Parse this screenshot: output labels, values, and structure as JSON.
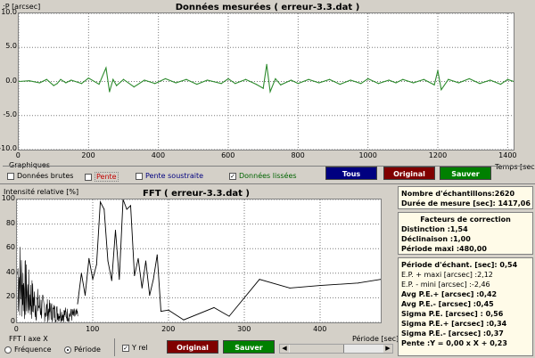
{
  "top": {
    "title": "Données mesurées ( erreur-3.3.dat )",
    "ylabel": ":P [arcsec]",
    "xlabel": "Temps [sec]",
    "yticks": [
      "10.0",
      "5.0",
      "0.0",
      "-5.0",
      "-10.0"
    ],
    "xticks": [
      "0",
      "200",
      "400",
      "600",
      "800",
      "1000",
      "1200",
      "1400"
    ]
  },
  "graphiques": {
    "label": "Graphiques",
    "cb_brutes": "Données brutes",
    "cb_pente": "Pente",
    "cb_soustraite": "Pente soustraite",
    "cb_lissees": "Données lissées",
    "btn_tous": "Tous",
    "btn_original": "Original",
    "btn_sauver": "Sauver"
  },
  "fft": {
    "title": "FFT ( erreur-3.3.dat )",
    "ylabel": "Intensité relative [%]",
    "xlabel": "Période [sec]",
    "yticks": [
      "100",
      "80",
      "60",
      "40",
      "20",
      "0"
    ],
    "xticks": [
      "0",
      "100",
      "200",
      "300",
      "400"
    ],
    "axe_label": "FFT I axe X",
    "radio_freq": "Fréquence",
    "radio_periode": "Période",
    "cb_yrel": "Y rel",
    "btn_original": "Original",
    "btn_sauver": "Sauver"
  },
  "info": {
    "nb": "Nombre d'échantillons:2620",
    "duree": "Durée de mesure [sec]: 1417,06"
  },
  "correction": {
    "header": "Facteurs de correction",
    "distinction": "Distinction :1,54",
    "declinaison": "Déclinaison :1,00",
    "periode": "Période maxi :480,00"
  },
  "stats": [
    "Période d'échant. [sec]: 0,54",
    "E.P. + maxi [arcsec] :2,12",
    "E.P. - mini [arcsec] :-2,46",
    "Avg P.E.+ [arcsec] :0,42",
    "Avg P.E.- [arcsec] :0,45",
    "Sigma P.E. [arcsec] : 0,56",
    "Sigma P.E.+ [arcsec] :0,34",
    "Sigma P.E.- [arcsec] :0,37",
    "Pente :Y = 0,00 x X + 0,23"
  ],
  "colors": {
    "tous": "#000080",
    "original": "#800000",
    "sauver": "#008000",
    "trace_green": "#2e8b2e",
    "trace_black": "#000000"
  },
  "chart_data": [
    {
      "type": "line",
      "title": "Données mesurées ( erreur-3.3.dat )",
      "ylabel": ":P [arcsec]",
      "xlabel": "Temps [sec]",
      "xlim": [
        0,
        1417
      ],
      "ylim": [
        -10,
        10
      ],
      "series": [
        {
          "x": [
            0,
            30,
            60,
            80,
            100,
            110,
            120,
            135,
            150,
            180,
            200,
            230,
            250,
            260,
            270,
            280,
            300,
            330,
            360,
            390,
            420,
            450,
            480,
            510,
            540,
            580,
            600,
            620,
            650,
            680,
            700,
            710,
            720,
            735,
            750,
            780,
            800,
            830,
            860,
            890,
            920,
            950,
            980,
            1000,
            1030,
            1060,
            1080,
            1100,
            1130,
            1160,
            1190,
            1200,
            1210,
            1230,
            1260,
            1290,
            1320,
            1350,
            1380,
            1400,
            1417
          ],
          "y": [
            0,
            0.1,
            -0.2,
            0.3,
            -0.6,
            -0.3,
            0.3,
            -0.2,
            0.2,
            -0.3,
            0.5,
            -0.4,
            2,
            -1.5,
            0.3,
            -0.6,
            0.3,
            -0.8,
            0.2,
            -0.3,
            0.4,
            -0.2,
            0.3,
            -0.4,
            0.2,
            -0.3,
            0.4,
            -0.3,
            0.3,
            -0.4,
            -1,
            2.5,
            -1.5,
            0.4,
            -0.5,
            0.2,
            -0.3,
            0.3,
            -0.2,
            0.3,
            -0.4,
            0.2,
            -0.3,
            0.4,
            -0.3,
            0.2,
            -0.2,
            0.3,
            -0.2,
            0.3,
            -0.5,
            1.6,
            -1.2,
            0.3,
            -0.2,
            0.4,
            -0.3,
            0.2,
            -0.4,
            0.3,
            0
          ]
        }
      ]
    },
    {
      "type": "line",
      "title": "FFT ( erreur-3.3.dat )",
      "ylabel": "Intensité relative [%]",
      "xlabel": "Période [sec]",
      "xlim": [
        0,
        480
      ],
      "ylim": [
        0,
        100
      ],
      "series": [
        {
          "x": [
            80,
            85,
            90,
            95,
            100,
            105,
            110,
            115,
            120,
            125,
            130,
            135,
            140,
            145,
            150,
            155,
            160,
            165,
            170,
            175,
            180,
            185,
            190,
            200,
            220,
            260,
            280,
            320,
            360,
            400,
            450,
            480
          ],
          "y": [
            15,
            40,
            22,
            52,
            35,
            47,
            98,
            92,
            50,
            34,
            75,
            35,
            100,
            92,
            95,
            38,
            52,
            28,
            50,
            22,
            35,
            55,
            9,
            10,
            2,
            12,
            5,
            35,
            28,
            30,
            32,
            35
          ]
        }
      ]
    }
  ]
}
